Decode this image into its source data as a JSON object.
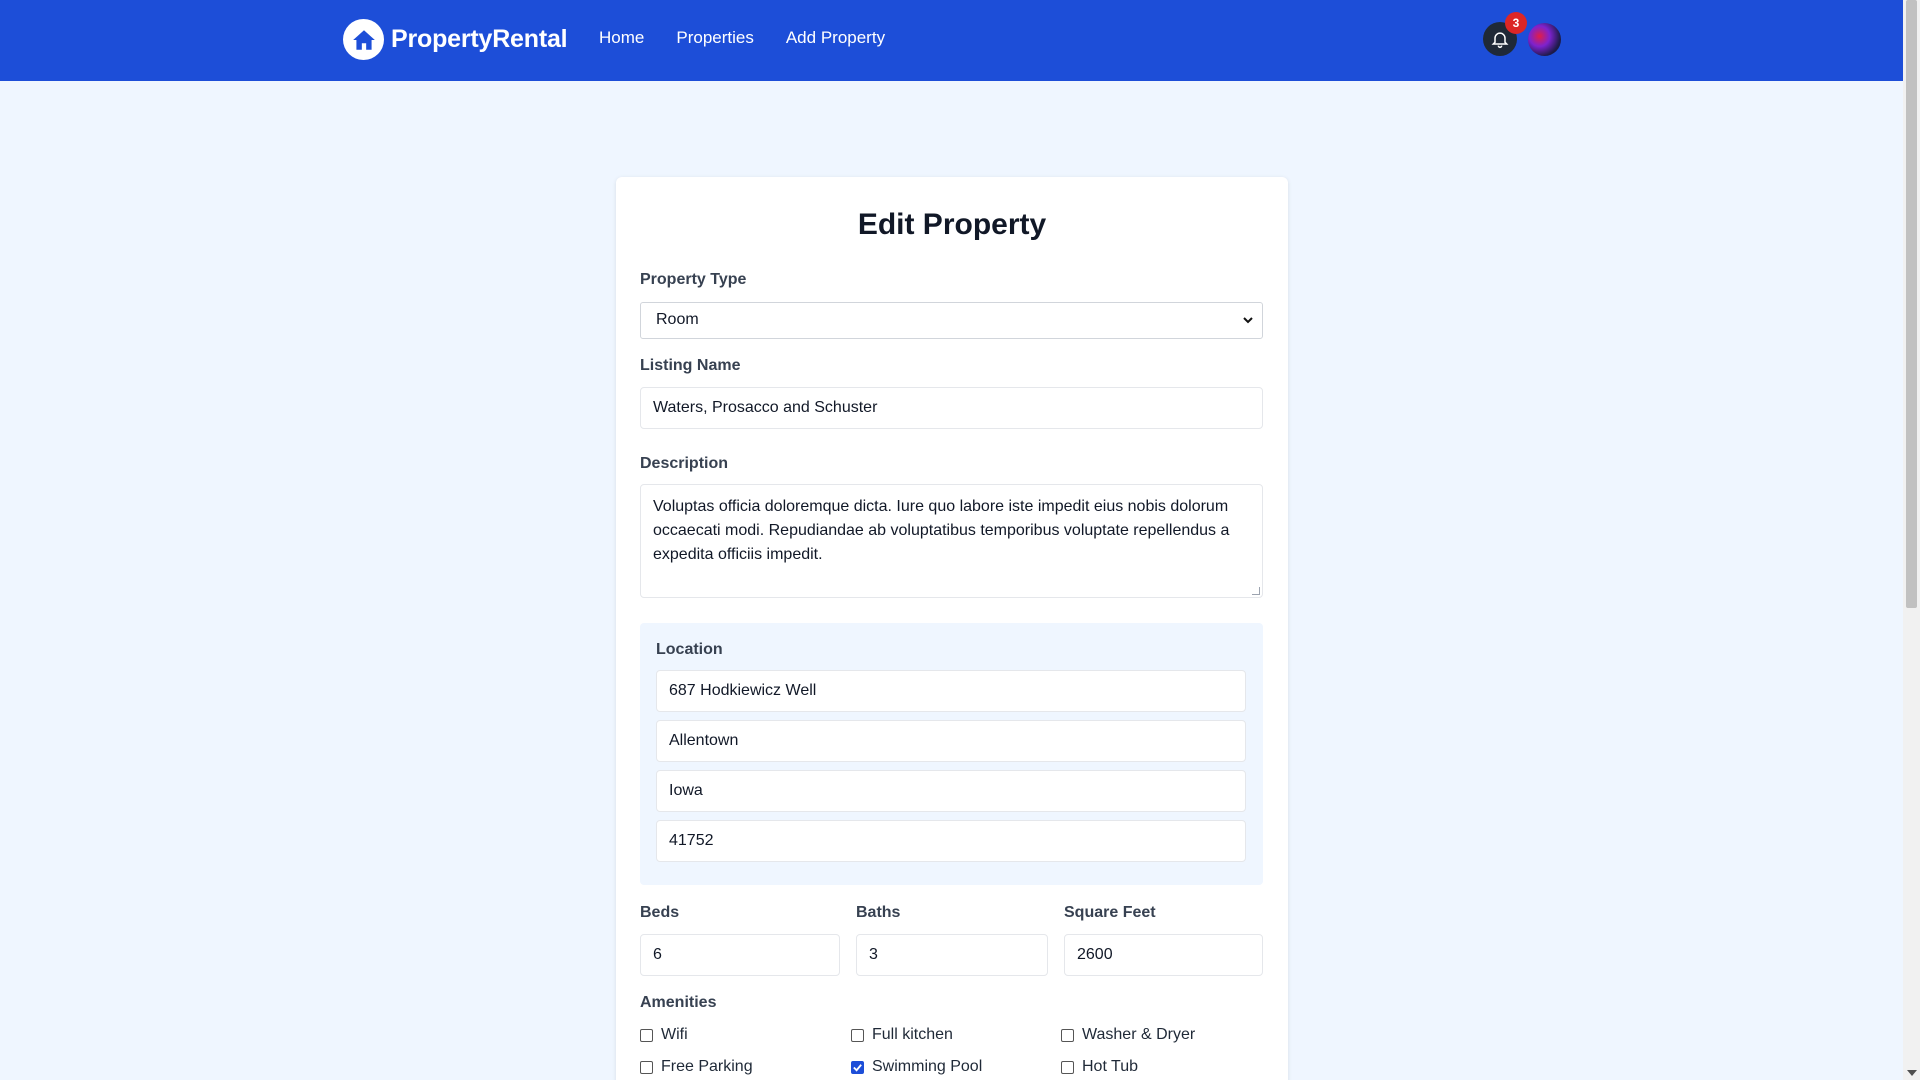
{
  "nav": {
    "brand": "PropertyRental",
    "links": [
      {
        "label": "Home"
      },
      {
        "label": "Properties"
      },
      {
        "label": "Add Property"
      }
    ],
    "notification_count": "3"
  },
  "form": {
    "title": "Edit Property",
    "property_type": {
      "label": "Property Type",
      "value": "Room"
    },
    "listing_name": {
      "label": "Listing Name",
      "value": "Waters, Prosacco and Schuster"
    },
    "description": {
      "label": "Description",
      "value": "Voluptas officia doloremque dicta. Iure quo labore iste impedit eius nobis dolorum occaecati modi. Repudiandae ab voluptatibus temporibus voluptate repellendus a expedita officiis impedit."
    },
    "location": {
      "label": "Location",
      "street": "687 Hodkiewicz Well",
      "city": "Allentown",
      "state": "Iowa",
      "zip": "41752"
    },
    "beds": {
      "label": "Beds",
      "value": "6"
    },
    "baths": {
      "label": "Baths",
      "value": "3"
    },
    "square_feet": {
      "label": "Square Feet",
      "value": "2600"
    },
    "amenities": {
      "label": "Amenities",
      "items": [
        {
          "label": "Wifi",
          "checked": false
        },
        {
          "label": "Full kitchen",
          "checked": false
        },
        {
          "label": "Washer & Dryer",
          "checked": false
        },
        {
          "label": "Free Parking",
          "checked": false
        },
        {
          "label": "Swimming Pool",
          "checked": true
        },
        {
          "label": "Hot Tub",
          "checked": false
        }
      ]
    }
  },
  "colors": {
    "nav_bg": "#1d4ed8",
    "page_bg": "#eff6ff",
    "badge": "#dc2626"
  }
}
